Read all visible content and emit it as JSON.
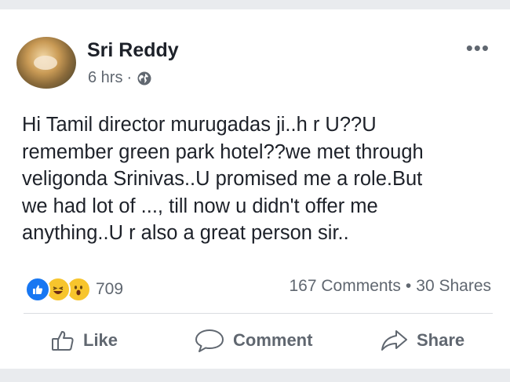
{
  "post": {
    "author": "Sri Reddy",
    "time": "6 hrs",
    "separator": "·",
    "privacy_icon": "globe-icon",
    "more_label": "•••",
    "text_lines": [
      "Hi Tamil director murugadas ji..h r U??U",
      "remember green park hotel??we met through",
      "veligonda Srinivas..U promised me a role.But",
      "we had lot of ..., till now  u didn't offer me",
      "anything..U r also a great person sir.."
    ]
  },
  "reactions": {
    "icons": [
      "like-icon",
      "haha-icon",
      "wow-icon"
    ],
    "count": "709"
  },
  "stats": {
    "comments": "167 Comments",
    "separator": "•",
    "shares": "30 Shares"
  },
  "actions": {
    "like": "Like",
    "comment": "Comment",
    "share": "Share"
  },
  "colors": {
    "background": "#e9ebee",
    "card": "#ffffff",
    "text": "#1d2129",
    "secondary": "#606770",
    "like_blue": "#1877f2",
    "emoji_yellow": "#f7c52d"
  }
}
